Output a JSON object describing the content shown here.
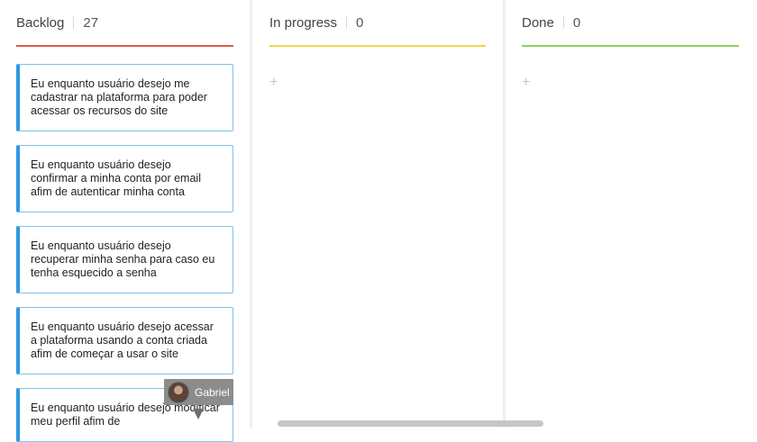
{
  "columns": [
    {
      "title": "Backlog",
      "count": "27",
      "accent": "#e05a44"
    },
    {
      "title": "In progress",
      "count": "0",
      "accent": "#f0d54a",
      "add_label": "+"
    },
    {
      "title": "Done",
      "count": "0",
      "accent": "#8fd05a",
      "add_label": "+"
    }
  ],
  "backlog_cards": [
    "Eu enquanto usuário desejo me cadastrar na plataforma para poder acessar os recursos do site",
    "Eu enquanto usuário desejo confirmar a minha conta por email afim de autenticar minha conta",
    "Eu enquanto usuário desejo recuperar minha senha para caso eu tenha esquecido a senha",
    "Eu enquanto usuário desejo acessar a plataforma usando a conta criada afim de começar a usar o site",
    "Eu enquanto usuário desejo modificar meu perfil afim de"
  ],
  "assignee": {
    "name": "Gabriel"
  },
  "colors": {
    "card_border": "#2f98e2"
  }
}
